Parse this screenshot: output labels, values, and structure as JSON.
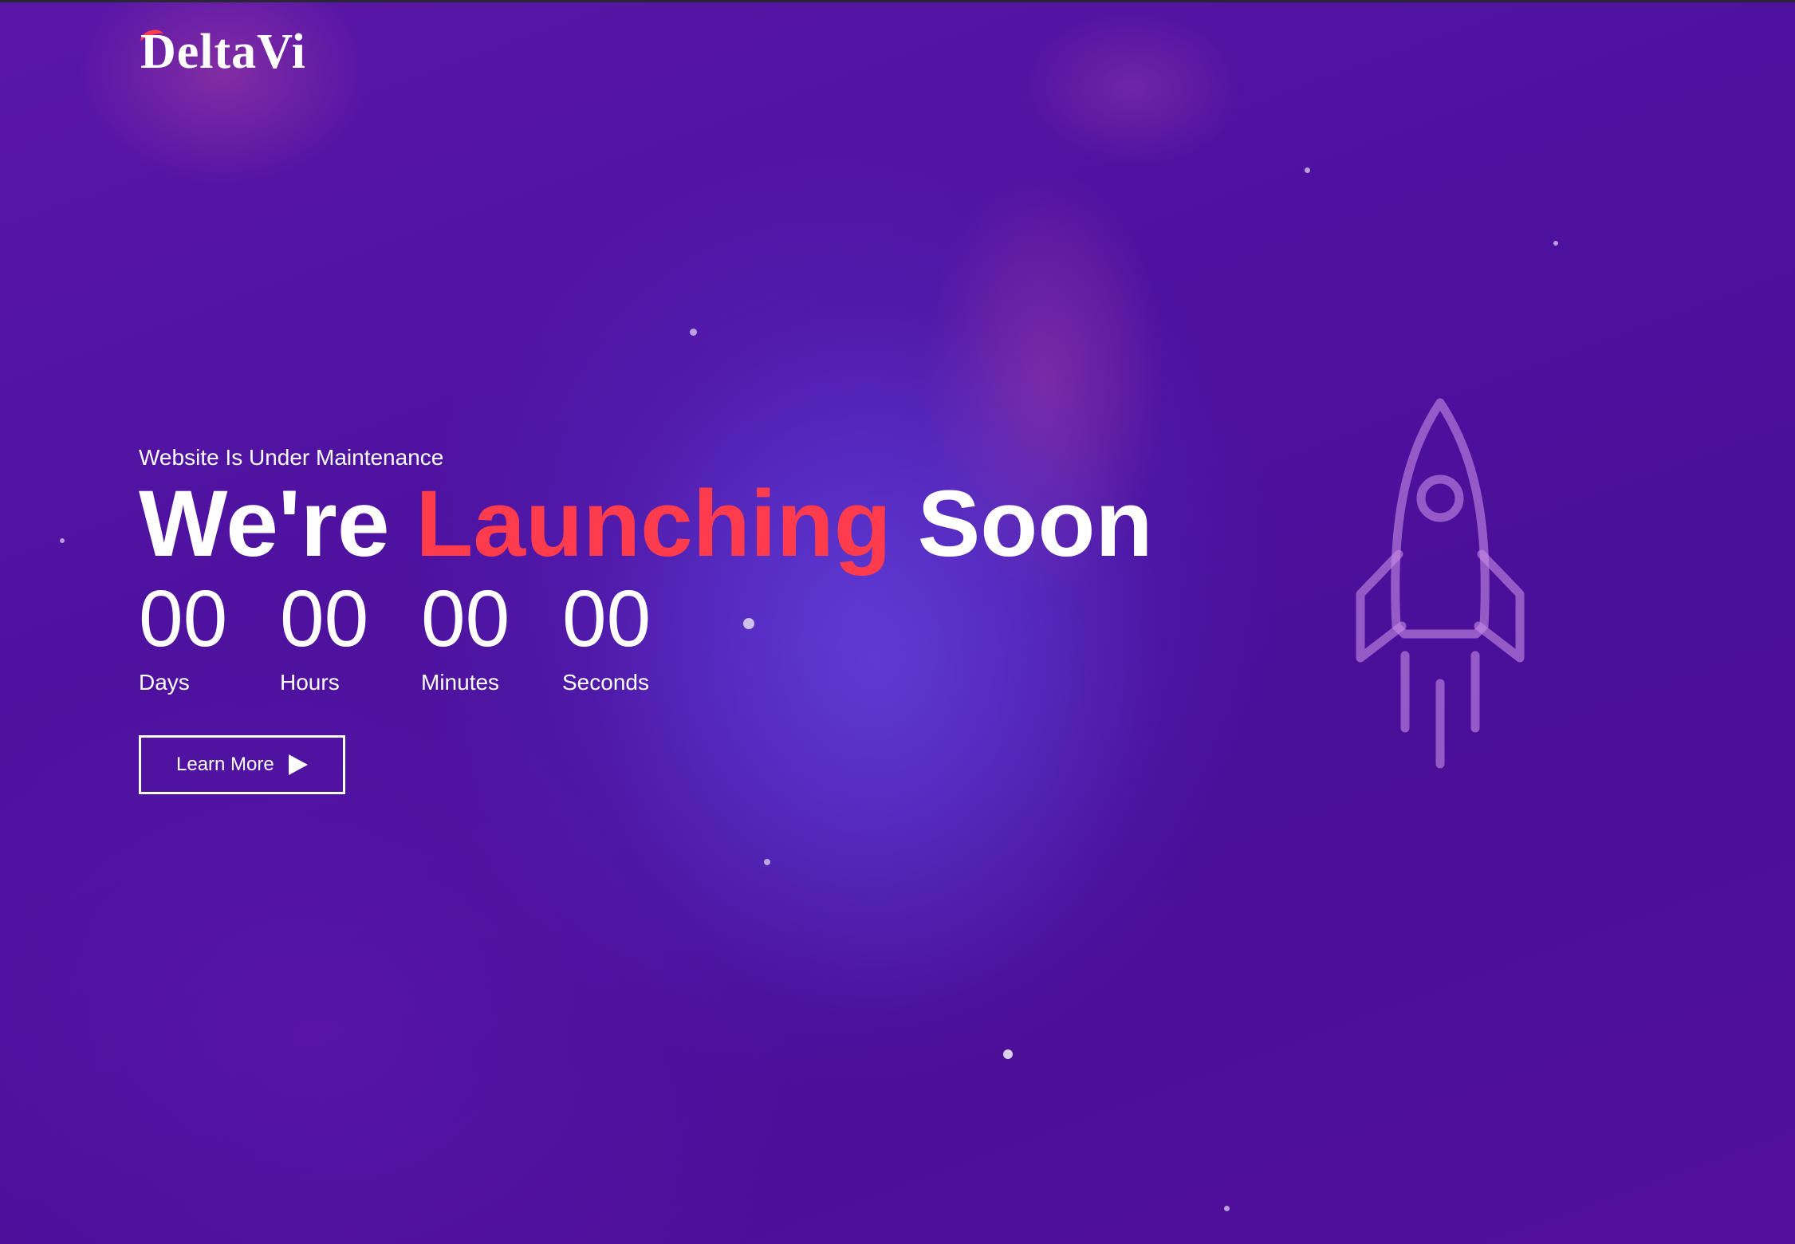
{
  "brand": {
    "name": "DeltaVi"
  },
  "hero": {
    "subtitle": "Website Is Under Maintenance",
    "headline": {
      "part1": "We're",
      "accent": "Launching",
      "part2": "Soon"
    }
  },
  "countdown": {
    "units": [
      {
        "value": "00",
        "label": "Days"
      },
      {
        "value": "00",
        "label": "Hours"
      },
      {
        "value": "00",
        "label": "Minutes"
      },
      {
        "value": "00",
        "label": "Seconds"
      }
    ]
  },
  "cta": {
    "label": "Learn More",
    "icon": "play-icon"
  },
  "illustration": {
    "icon": "rocket-icon"
  },
  "colors": {
    "accent": "#ff3b4e",
    "background": "#4f12a0",
    "text": "#ffffff"
  }
}
